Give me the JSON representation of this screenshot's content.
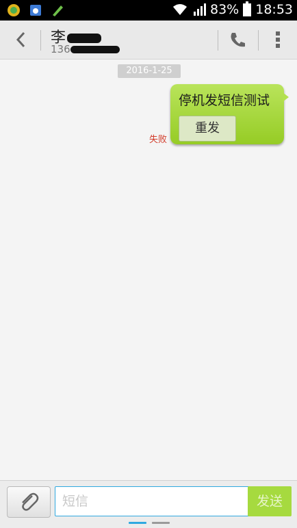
{
  "status_bar": {
    "battery_percent": "83%",
    "time": "18:53"
  },
  "header": {
    "contact_name": "李",
    "contact_number": "136"
  },
  "conversation": {
    "date": "2016-1-25",
    "messages": [
      {
        "text": "停机发短信测试",
        "status": "失败",
        "resend_label": "重发"
      }
    ]
  },
  "input_bar": {
    "placeholder": "短信",
    "send_label": "发送"
  },
  "colors": {
    "bubble": "#a6d83a",
    "fail": "#d23b2a",
    "input_border": "#2fa9e0",
    "send_button": "#a6da3f"
  }
}
